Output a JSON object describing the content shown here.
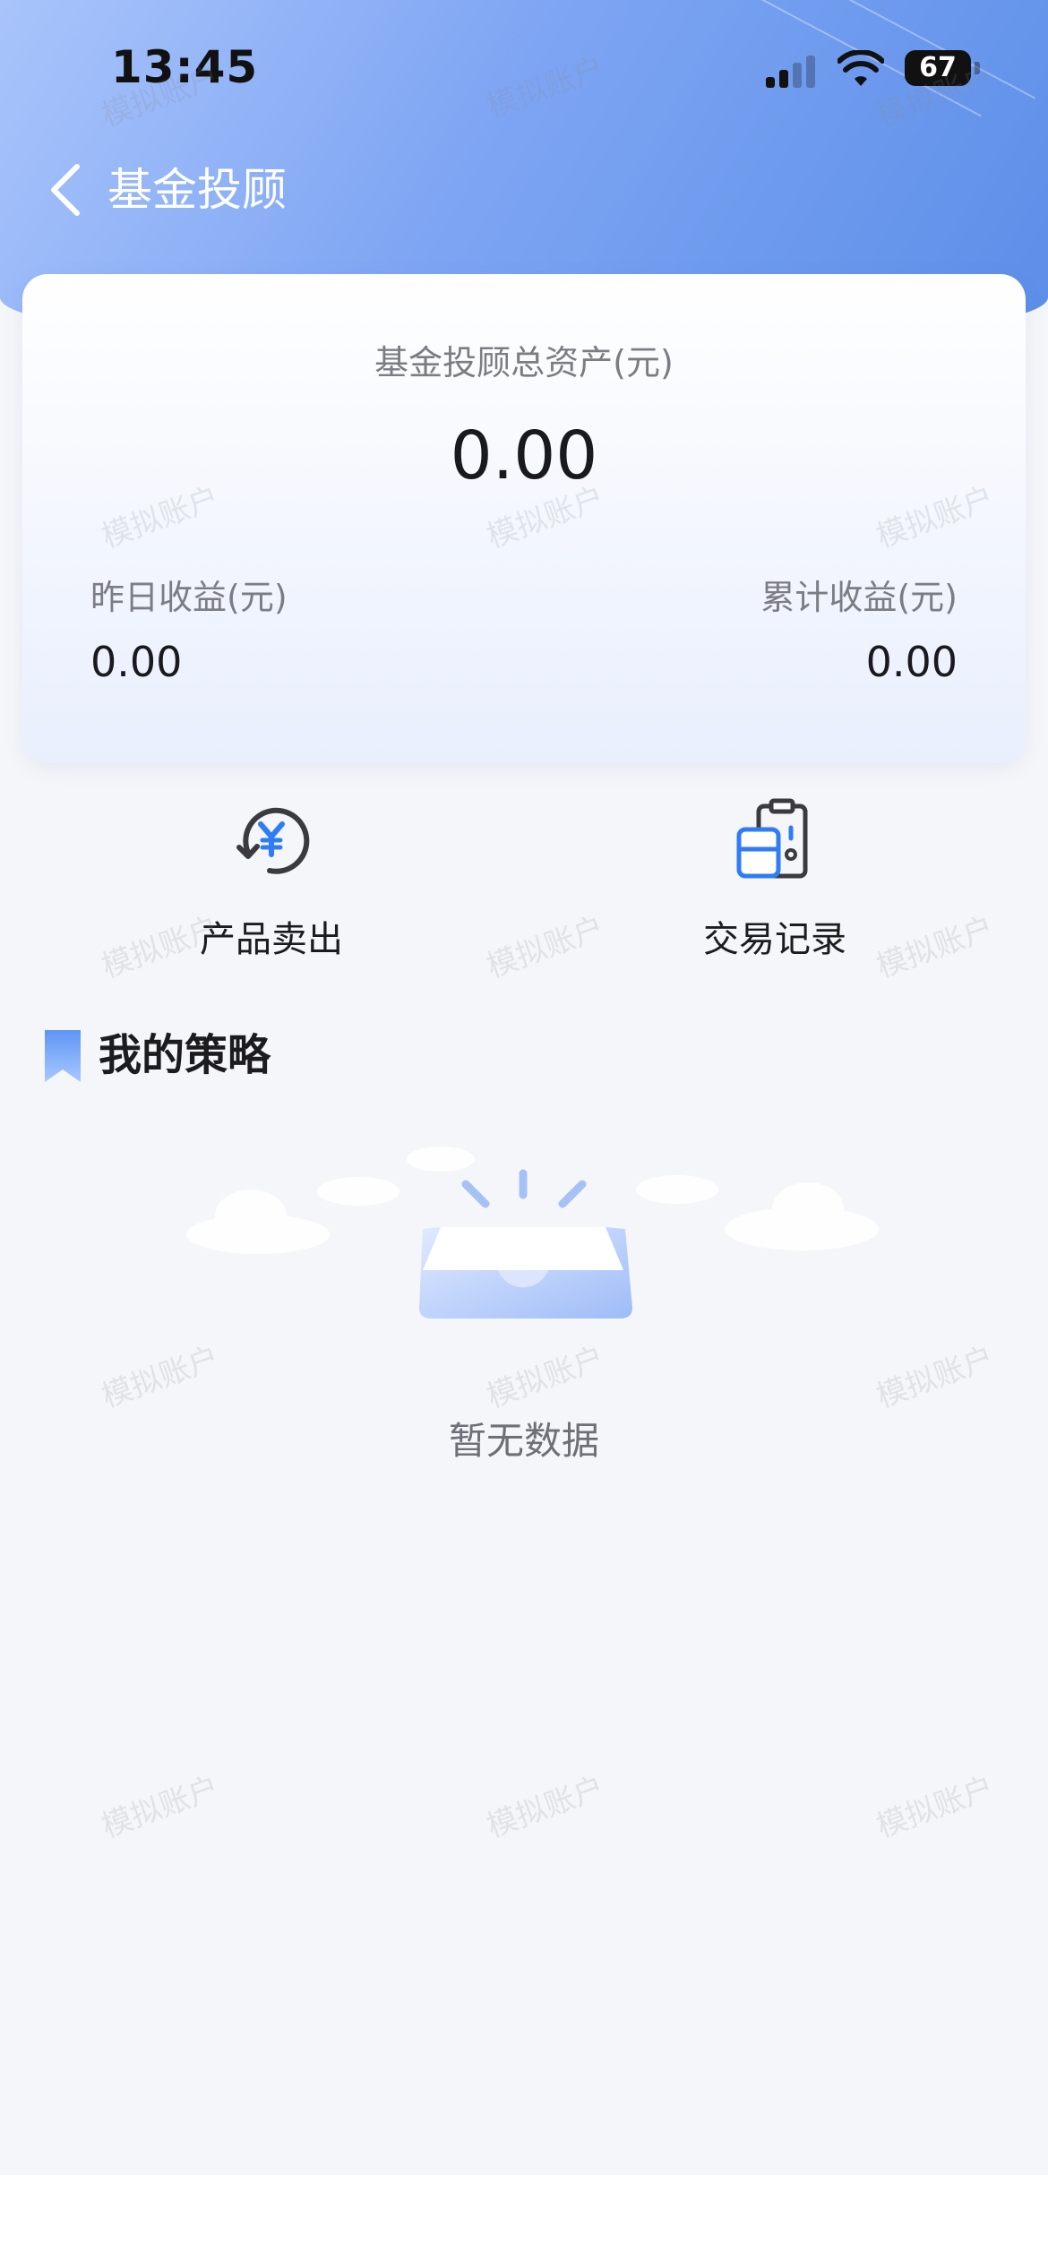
{
  "status_bar": {
    "time": "13:45",
    "battery": "67"
  },
  "nav": {
    "title": "基金投顾"
  },
  "summary": {
    "total_label": "基金投顾总资产(元)",
    "total_value": "0.00",
    "yesterday_label": "昨日收益(元)",
    "yesterday_value": "0.00",
    "cumulative_label": "累计收益(元)",
    "cumulative_value": "0.00"
  },
  "actions": [
    {
      "label": "产品卖出",
      "icon": "redeem-yen-icon"
    },
    {
      "label": "交易记录",
      "icon": "transaction-record-icon"
    }
  ],
  "strategy": {
    "title": "我的策略",
    "empty_text": "暂无数据"
  },
  "watermark": "模拟账户",
  "colors": {
    "accent": "#2f7cf6",
    "header_start": "#a9c4fb",
    "header_end": "#5b8ee8",
    "background": "#f5f6f9"
  }
}
